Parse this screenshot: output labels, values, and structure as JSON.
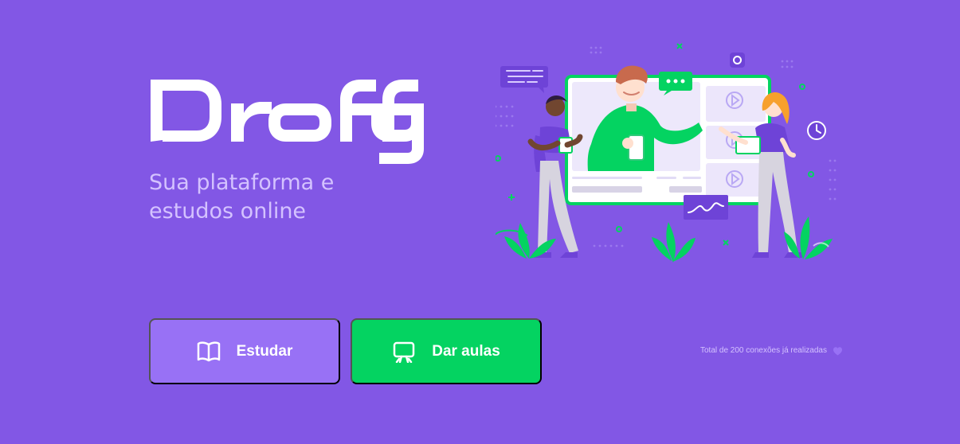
{
  "app": {
    "name": "Proffy",
    "tagline_line_1": "Sua plataforma e",
    "tagline_line_2": "estudos online"
  },
  "hero": {
    "illustration": "online-learning-illustration"
  },
  "actions": {
    "study_label": "Estudar",
    "study_icon": "book-icon",
    "give_classes_label": "Dar aulas",
    "give_classes_icon": "presentation-board-icon"
  },
  "status": {
    "connections_text": "Total de 200 conexões já realizadas",
    "connections_icon": "purple-heart-icon"
  },
  "colors": {
    "background": "#8257e5",
    "logo": "#ffffff",
    "tagline": "#d4c2ff",
    "study_button": "#9871f5",
    "give_button": "#04d361",
    "accent_green": "#04d361",
    "heart": "#9871f5"
  }
}
